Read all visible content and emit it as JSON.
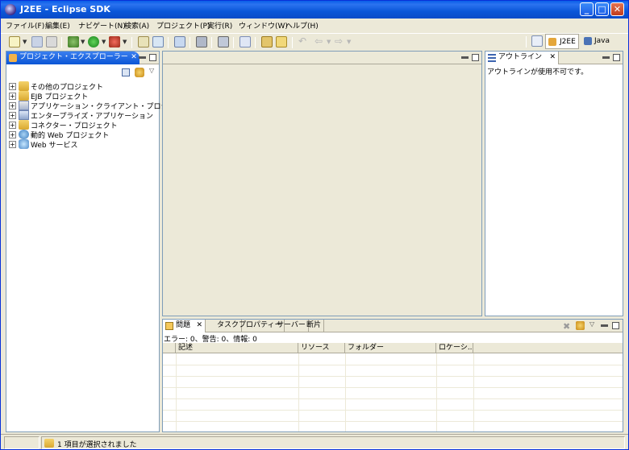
{
  "window": {
    "title": "J2EE - Eclipse SDK",
    "minimize": "_",
    "maximize": "□",
    "close": "✕"
  },
  "menu": [
    "ファイル(F)",
    "編集(E)",
    "ナビゲート(N)",
    "検索(A)",
    "プロジェクト(P)",
    "実行(R)",
    "ウィンドウ(W)",
    "ヘルプ(H)"
  ],
  "perspectives": {
    "active": "J2EE",
    "other": "Java"
  },
  "project_explorer": {
    "tab_label": "プロジェクト・エクスプローラー",
    "close_glyph": "✕",
    "items": [
      {
        "label": "その他のプロジェクト",
        "icon": "folder-icon"
      },
      {
        "label": "EJB プロジェクト",
        "icon": "ejb-icon"
      },
      {
        "label": "アプリケーション・クライアント・プロジェクト",
        "icon": "app-client-icon"
      },
      {
        "label": "エンタープライズ・アプリケーション",
        "icon": "enterprise-app-icon"
      },
      {
        "label": "コネクター・プロジェクト",
        "icon": "connector-icon"
      },
      {
        "label": "動的 Web プロジェクト",
        "icon": "web-project-icon"
      },
      {
        "label": "Web サービス",
        "icon": "web-service-icon"
      }
    ],
    "expander": "+"
  },
  "outline": {
    "tab_label": "アウトライン",
    "close_glyph": "✕",
    "message": "アウトラインが使用不可です。"
  },
  "problems": {
    "tabs": [
      "問題",
      "タスク",
      "プロパティー",
      "サーバー",
      "断片"
    ],
    "close_glyph": "✕",
    "summary": "エラー: 0、警告: 0、情報: 0",
    "columns": [
      "記述",
      "リソース",
      "フォルダー",
      "ロケーシ..."
    ]
  },
  "status": {
    "message": "1 項目が選択されました"
  },
  "colors": {
    "title_bar": "#0a56d8",
    "active_tab": "#0a55d5",
    "frame_bg": "#ece9d8"
  }
}
